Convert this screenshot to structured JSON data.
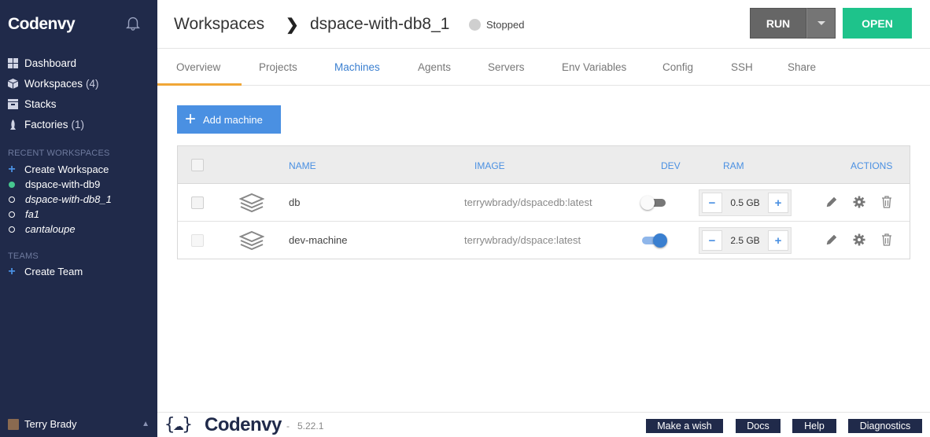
{
  "sidebar": {
    "brand": "Codenvy",
    "nav": [
      {
        "label": "Dashboard",
        "count": ""
      },
      {
        "label": "Workspaces",
        "count": "(4)"
      },
      {
        "label": "Stacks",
        "count": ""
      },
      {
        "label": "Factories",
        "count": "(1)"
      }
    ],
    "recent_title": "RECENT WORKSPACES",
    "create_workspace": "Create Workspace",
    "recent": [
      {
        "label": "dspace-with-db9",
        "state": "running"
      },
      {
        "label": "dspace-with-db8_1",
        "state": "stopped"
      },
      {
        "label": "fa1",
        "state": "stopped"
      },
      {
        "label": "cantaloupe",
        "state": "stopped"
      }
    ],
    "teams_title": "TEAMS",
    "create_team": "Create Team",
    "user": "Terry Brady"
  },
  "header": {
    "root": "Workspaces",
    "workspace": "dspace-with-db8_1",
    "status": "Stopped",
    "run": "RUN",
    "open": "OPEN"
  },
  "tabs": [
    "Overview",
    "Projects",
    "Machines",
    "Agents",
    "Servers",
    "Env Variables",
    "Config",
    "SSH",
    "Share"
  ],
  "active_tab": "Machines",
  "add_machine": "Add machine",
  "table": {
    "headers": {
      "name": "NAME",
      "image": "IMAGE",
      "dev": "DEV",
      "ram": "RAM",
      "actions": "ACTIONS"
    },
    "rows": [
      {
        "name": "db",
        "image": "terrywbrady/dspacedb:latest",
        "dev": false,
        "ram": "0.5 GB"
      },
      {
        "name": "dev-machine",
        "image": "terrywbrady/dspace:latest",
        "dev": true,
        "ram": "2.5 GB"
      }
    ]
  },
  "footer": {
    "brand": "Codenvy",
    "version": "5.22.1",
    "make_wish": "Make a wish",
    "docs": "Docs",
    "help": "Help",
    "diagnostics": "Diagnostics"
  },
  "colors": {
    "sidebar": "#202a4a",
    "accent": "#4a90e2",
    "open": "#1ec38b",
    "tab_underline": "#f0a637"
  }
}
